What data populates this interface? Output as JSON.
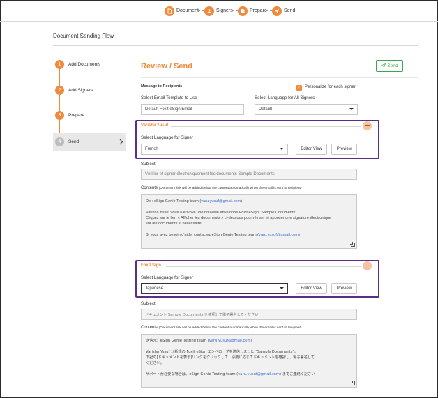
{
  "top_steps": [
    {
      "label": "Document",
      "icon": "document-icon"
    },
    {
      "label": "Signers",
      "icon": "user-icon"
    },
    {
      "label": "Prepare",
      "icon": "file-icon"
    },
    {
      "label": "Send",
      "icon": "send-icon"
    }
  ],
  "flow_title": "Document Sending Flow",
  "left_steps": [
    {
      "num": "1",
      "label": "Add Documents"
    },
    {
      "num": "2",
      "label": "Add Signers"
    },
    {
      "num": "3",
      "label": "Prepare"
    },
    {
      "num": "4",
      "label": "Send"
    }
  ],
  "review": {
    "title": "Review / Send",
    "send_label": "Send",
    "personalize_label": "Personalize for each signer",
    "message_label": "Message to Recipients",
    "template_label": "Select Email Template to Use",
    "template_value": "Default Foxit eSign Email",
    "all_lang_label": "Select Language for All Signers",
    "all_lang_value": "Default"
  },
  "signers": [
    {
      "name": "Varisha Yusuf",
      "lang_label": "Select Language for Signer",
      "lang_value": "French",
      "editor_view": "Editor View",
      "preview": "Preview",
      "subject_label": "Subject",
      "subject_value": "Vérifier et signer électroniquement les documents Sample Documents",
      "contents_label": "Contents",
      "contents_note": "(Document link will be added below the content automatically when the email is sent to recipient)",
      "body": {
        "from_prefix": "De : eSign Genie Testing team (",
        "from_email": "varu.yusuf@gmail.com",
        "from_suffix": ")",
        "line1": "Varisha Yusuf vous a envoyé une nouvelle enveloppe Foxit eSign \"Sample Documents\".",
        "line2": "Cliquez sur le lien « Afficher les documents » ci-dessous pour réviser et apposer une signature électronique",
        "line3": "sur les documents si nécessaire.",
        "help_prefix": "Si vous avez besoin d'aide, contactez eSign Genie Testing team (",
        "help_email": "varu.yusuf@gmail.com",
        "help_suffix": ")"
      }
    },
    {
      "name": "Foxit Sign",
      "lang_label": "Select Language for Signer",
      "lang_value": "Japanese",
      "editor_view": "Editor View",
      "preview": "Preview",
      "subject_label": "Subject",
      "subject_value": "ドキュメント Sample Documents を確認して電子署名してください",
      "contents_label": "Contents",
      "contents_note": "(Document link will be added below the content automatically when the email is sent to recipient)",
      "body": {
        "from_prefix": "送信元：eSign Genie Testing team (",
        "from_email": "varu.yusuf@gmail.com",
        "from_suffix": ")",
        "line1": "Varisha Yusuf が新規の Foxit eSign エンベロープを送信しました \"Sample Documents\"。",
        "line2": "下記の[ドキュメントを表示]リンクをクリックして、必要に応じてドキュメントを確認し、電子署名して",
        "line3": "ください。",
        "help_prefix": "サポートが必要な場合は、eSign Genie Testing team (",
        "help_email": "varu.yusuf@gmail.com",
        "help_suffix": ") までご連絡ください"
      }
    }
  ],
  "colors": {
    "accent": "#f08a3c",
    "highlight": "#5a2f8a",
    "send_green": "#3aa655",
    "link": "#3a6fd8"
  }
}
